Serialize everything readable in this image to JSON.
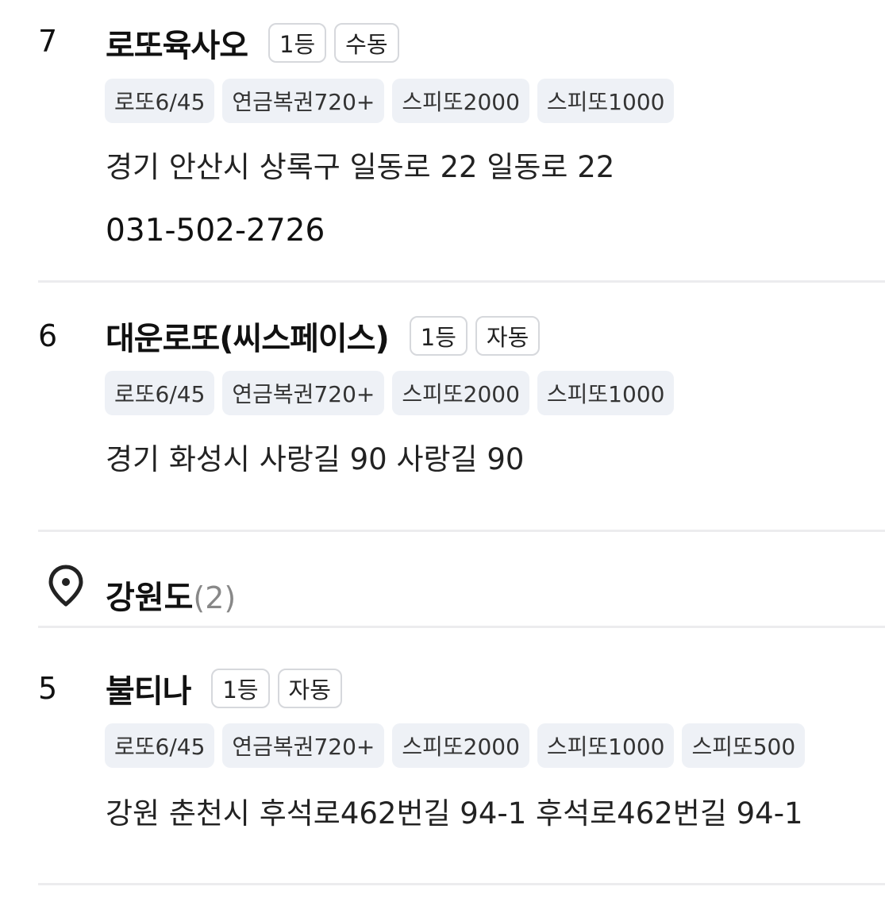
{
  "stores": [
    {
      "rank": "7",
      "name": "로또육사오",
      "badges": [
        "1등",
        "수동"
      ],
      "tags": [
        "로또6/45",
        "연금복권720+",
        "스피또2000",
        "스피또1000"
      ],
      "address": "경기 안산시 상록구 일동로 22 일동로 22",
      "phone": "031-502-2726"
    },
    {
      "rank": "6",
      "name": "대운로또(씨스페이스)",
      "badges": [
        "1등",
        "자동"
      ],
      "tags": [
        "로또6/45",
        "연금복권720+",
        "스피또2000",
        "스피또1000"
      ],
      "address": "경기 화성시 사랑길 90 사랑길 90"
    },
    {
      "rank": "5",
      "name": "불티나",
      "badges": [
        "1등",
        "자동"
      ],
      "tags": [
        "로또6/45",
        "연금복권720+",
        "스피또2000",
        "스피또1000",
        "스피또500"
      ],
      "address": "강원 춘천시 후석로462번길 94-1 후석로462번길 94-1"
    }
  ],
  "region": {
    "icon": "map-pin-icon",
    "name": "강원도",
    "count": "(2)"
  },
  "colors": {
    "tag_bg": "#eef1f6",
    "divider": "#ececee",
    "count_gray": "#888888"
  }
}
